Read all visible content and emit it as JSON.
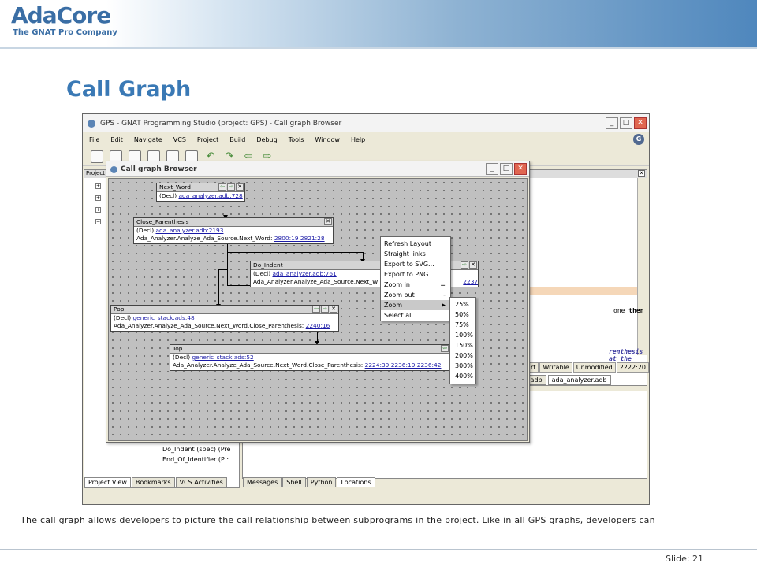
{
  "slide": {
    "logo_mark": "AdaCore",
    "logo_tagline": "The GNAT Pro Company",
    "title": "Call Graph",
    "caption": "The call graph allows developers to picture the call relationship between subprograms in the project. Like in all GPS graphs, developers can",
    "slide_number": "Slide: 21"
  },
  "gps": {
    "window_title": "GPS - GNAT Programming Studio (project: GPS) - Call graph Browser",
    "menu": [
      "File",
      "Edit",
      "Navigate",
      "VCS",
      "Project",
      "Build",
      "Debug",
      "Tools",
      "Window",
      "Help"
    ],
    "help_badge": "G",
    "project_header": "Project",
    "tree_items": [
      "Do_Indent (spec) (Pre",
      "End_Of_Identifier (P :"
    ],
    "left_tabs": [
      "Project View",
      "Bookmarks",
      "VCS Activities"
    ],
    "bottom_tabs": [
      "Messages",
      "Shell",
      "Python",
      "Locations"
    ],
    "code_line_1_prefix": "one ",
    "code_line_1_kw": "then",
    "code_line_2": "renthesis at the",
    "status": [
      "rt",
      "Writable",
      "Unmodified",
      "2222:20"
    ],
    "file_tabs": [
      ".adb",
      "ada_analyzer.adb"
    ]
  },
  "call_graph": {
    "title": "Call graph Browser",
    "nodes": {
      "next_word": {
        "name": "Next_Word",
        "decl_prefix": "(Decl) ",
        "decl_link": "ada_analyzer.adb:728"
      },
      "close_paren": {
        "name": "Close_Parenthesis",
        "decl_prefix": "(Decl) ",
        "decl_link": "ada_analyzer.adb:2193",
        "call_text": "Ada_Analyzer.Analyze_Ada_Source.Next_Word: ",
        "call_links": "2800:19 2821:28"
      },
      "do_indent": {
        "name": "Do_Indent",
        "decl_prefix": "(Decl) ",
        "decl_link": "ada_analyzer.adb:761",
        "call_text": "Ada_Analyzer.Analyze_Ada_Source.Next_W",
        "call_links": "2237:19"
      },
      "pop": {
        "name": "Pop",
        "decl_prefix": "(Decl) ",
        "decl_link": "generic_stack.ads:48",
        "call_text": "Ada_Analyzer.Analyze_Ada_Source.Next_Word.Close_Parenthesis: ",
        "call_links": "2240:16"
      },
      "top": {
        "name": "Top",
        "decl_prefix": "(Decl) ",
        "decl_link": "generic_stack.ads:52",
        "call_text": "Ada_Analyzer.Analyze_Ada_Source.Next_Word.Close_Parenthesis: ",
        "call_links": "2224:39 2236:19 2236:42"
      }
    }
  },
  "context_menu": {
    "items": [
      "Refresh Layout",
      "Straight links",
      "Export to SVG...",
      "Export to PNG...",
      "Zoom in",
      "Zoom out",
      "Zoom",
      "Select all"
    ],
    "zoom_in_shortcut": "=",
    "zoom_out_shortcut": "-",
    "submenu_arrow": "▶",
    "highlighted": "Zoom"
  },
  "zoom_menu": {
    "items": [
      "25%",
      "50%",
      "75%",
      "100%",
      "150%",
      "200%",
      "300%",
      "400%"
    ]
  }
}
